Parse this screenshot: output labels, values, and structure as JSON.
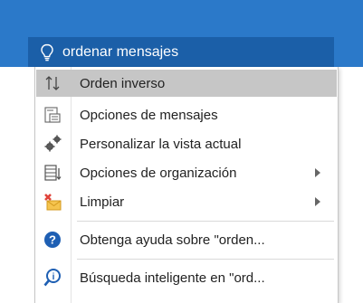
{
  "search": {
    "query": "ordenar mensajes",
    "icon": "lightbulb-icon"
  },
  "menu": {
    "items": [
      {
        "label": "Orden inverso",
        "icon": "reverse-sort-icon",
        "highlighted": true,
        "submenu": false
      },
      {
        "label": "Opciones de mensajes",
        "icon": "message-options-icon",
        "highlighted": false,
        "submenu": false
      },
      {
        "label": "Personalizar la vista actual",
        "icon": "customize-view-icon",
        "highlighted": false,
        "submenu": false
      },
      {
        "label": "Opciones de organización",
        "icon": "arrangement-options-icon",
        "highlighted": false,
        "submenu": true
      },
      {
        "label": "Limpiar",
        "icon": "clean-up-icon",
        "highlighted": false,
        "submenu": true
      },
      {
        "label": "Obtenga ayuda sobre \"orden...",
        "icon": "help-icon",
        "highlighted": false,
        "submenu": false
      },
      {
        "label": "Búsqueda inteligente en \"ord...",
        "icon": "smart-lookup-icon",
        "highlighted": false,
        "submenu": false
      }
    ]
  },
  "colors": {
    "ribbon": "#2b79c9",
    "search_box": "#1b5fa8",
    "highlight": "#c6c6c6",
    "help_blue": "#1e5fb3"
  }
}
